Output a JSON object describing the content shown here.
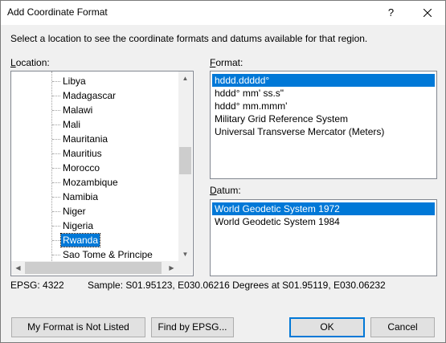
{
  "dialog": {
    "title": "Add Coordinate Format",
    "help_label": "?",
    "instructions": "Select a location to see the coordinate formats and datums available for that region."
  },
  "location": {
    "label_accel": "L",
    "label_rest": "ocation:",
    "items": [
      "Libya",
      "Madagascar",
      "Malawi",
      "Mali",
      "Mauritania",
      "Mauritius",
      "Morocco",
      "Mozambique",
      "Namibia",
      "Niger",
      "Nigeria",
      "Rwanda",
      "Sao Tome & Principe"
    ],
    "selected": "Rwanda",
    "scroll_position_fraction": 0.46
  },
  "format": {
    "label_accel": "F",
    "label_rest": "ormat:",
    "items": [
      "hddd.ddddd°",
      "hddd° mm' ss.s\"",
      "hddd° mm.mmm'",
      "Military Grid Reference System",
      "Universal Transverse Mercator (Meters)"
    ],
    "selected": "hddd.ddddd°"
  },
  "datum": {
    "label_accel": "D",
    "label_rest": "atum:",
    "items": [
      "World Geodetic System 1972",
      "World Geodetic System 1984"
    ],
    "selected": "World Geodetic System 1972"
  },
  "status": {
    "epsg": "EPSG: 4322",
    "sample": "Sample: S01.95123, E030.06216 Degrees at S01.95119, E030.06232"
  },
  "buttons": {
    "not_listed": "My Format is Not Listed",
    "find_epsg": "Find by EPSG...",
    "ok": "OK",
    "cancel": "Cancel"
  },
  "colors": {
    "selection": "#0078d7",
    "dialog_bg": "#f0f0f0"
  },
  "icons": {
    "close": "close-icon",
    "scroll_up": "chevron-up-icon",
    "scroll_down": "chevron-down-icon",
    "scroll_left": "chevron-left-icon",
    "scroll_right": "chevron-right-icon"
  }
}
